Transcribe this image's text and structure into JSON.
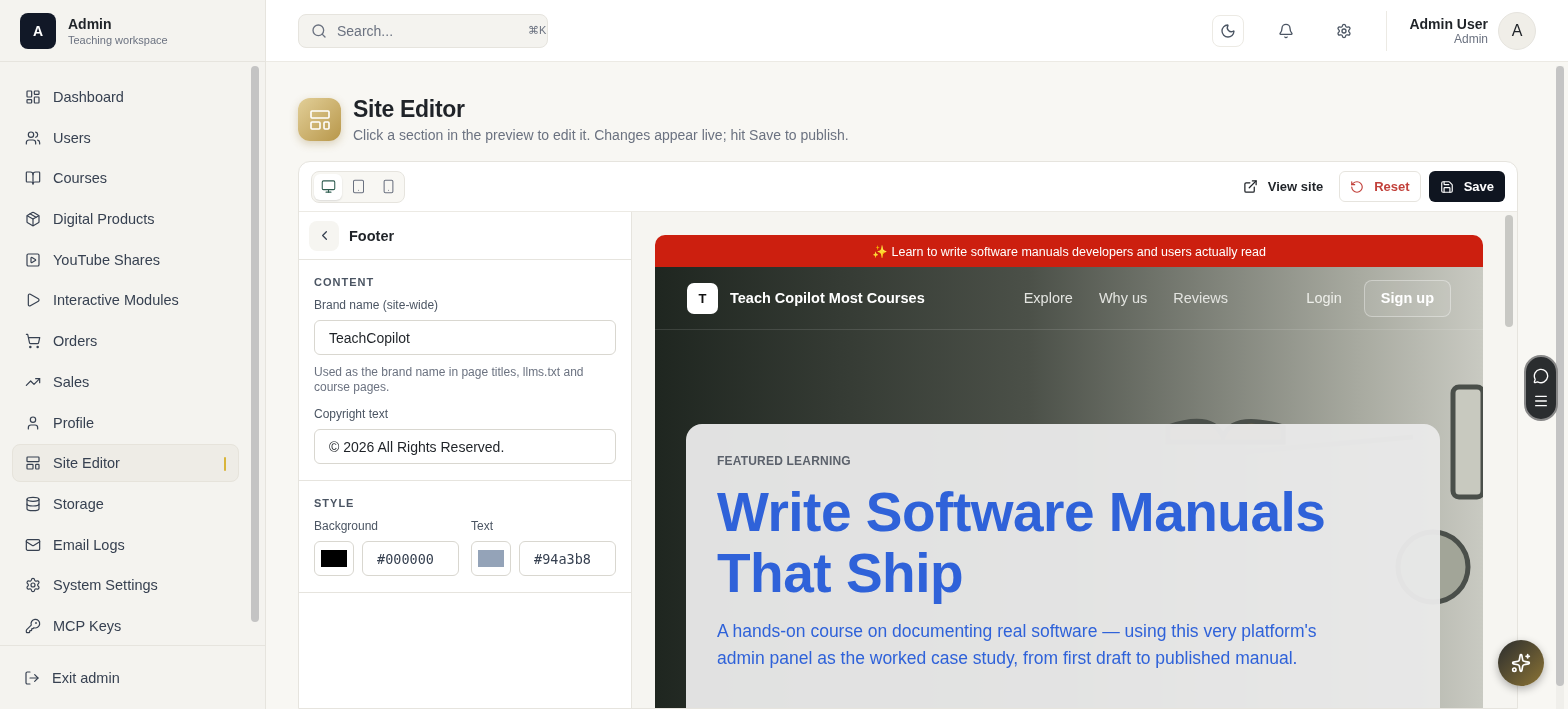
{
  "workspace": {
    "logo_letter": "A",
    "name": "Admin",
    "subtitle": "Teaching workspace"
  },
  "sidebar": {
    "items": [
      {
        "label": "Dashboard",
        "selected": false
      },
      {
        "label": "Users",
        "selected": false
      },
      {
        "label": "Courses",
        "selected": false
      },
      {
        "label": "Digital Products",
        "selected": false
      },
      {
        "label": "YouTube Shares",
        "selected": false
      },
      {
        "label": "Interactive Modules",
        "selected": false
      },
      {
        "label": "Orders",
        "selected": false
      },
      {
        "label": "Sales",
        "selected": false
      },
      {
        "label": "Profile",
        "selected": false
      },
      {
        "label": "Site Editor",
        "selected": true
      },
      {
        "label": "Storage",
        "selected": false
      },
      {
        "label": "Email Logs",
        "selected": false
      },
      {
        "label": "System Settings",
        "selected": false
      },
      {
        "label": "MCP Keys",
        "selected": false
      }
    ],
    "exit": "Exit admin"
  },
  "header": {
    "search": {
      "placeholder": "Search...",
      "shortcut": "⌘K"
    },
    "user": {
      "name": "Admin User",
      "role": "Admin",
      "avatar_letter": "A"
    }
  },
  "page": {
    "title": "Site Editor",
    "subtitle": "Click a section in the preview to edit it. Changes appear live; hit Save to publish."
  },
  "toolbar": {
    "devices": [
      {
        "selected": true
      },
      {
        "selected": false
      },
      {
        "selected": false
      }
    ],
    "view_site": "View site",
    "reset": "Reset",
    "save": "Save"
  },
  "panel": {
    "title": "Footer",
    "content_heading": "CONTENT",
    "brand_label": "Brand name (site-wide)",
    "brand_value": "TeachCopilot",
    "brand_help": "Used as the brand name in page titles, llms.txt and course pages.",
    "copyright_label": "Copyright text",
    "copyright_value": "© 2026 All Rights Reserved.",
    "style_heading": "STYLE",
    "colors": [
      {
        "label": "Background",
        "color": "#000000",
        "value": "#000000"
      },
      {
        "label": "Text",
        "color": "#94a3b8",
        "value": "#94a3b8"
      }
    ]
  },
  "preview": {
    "announcement": "✨ Learn to write software manuals developers and users actually read",
    "logo_letter": "T",
    "brand": "Teach Copilot Most Courses",
    "nav": [
      "Explore",
      "Why us",
      "Reviews"
    ],
    "login": "Login",
    "signup": "Sign up",
    "eyebrow": "FEATURED LEARNING",
    "headline": "Write Software Manuals That Ship",
    "lead": "A hands-on course on documenting real software — using this very platform's admin panel as the worked case study, from first draft to published manual."
  }
}
